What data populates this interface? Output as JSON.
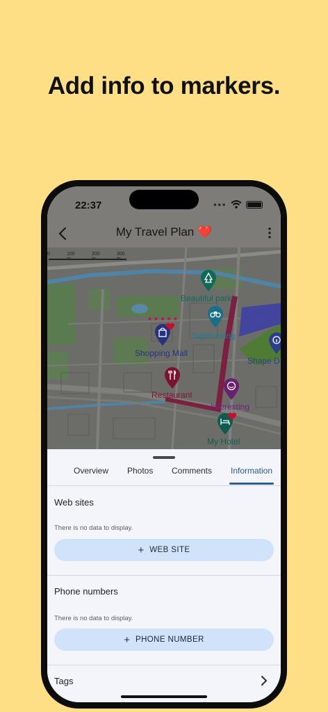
{
  "headline": "Add info to markers.",
  "status_bar": {
    "time": "22:37"
  },
  "app_bar": {
    "title": "My Travel Plan ❤️"
  },
  "map": {
    "scale_labels": [
      "0",
      "100 m",
      "200 m",
      "300 m"
    ],
    "markers": [
      {
        "label": "Beautiful park",
        "icon": "tree-icon",
        "color": "#0f6a58"
      },
      {
        "label": "Sightseeing",
        "icon": "binoculars-icon",
        "color": "#1a6f88"
      },
      {
        "label": "Shopping Mall",
        "icon": "shopping-bag-icon",
        "color": "#26327c"
      },
      {
        "label": "Shape D",
        "icon": "info-icon",
        "color": "#2d3f86"
      },
      {
        "label": "Restaurant",
        "icon": "fork-knife-icon",
        "color": "#7a1232"
      },
      {
        "label": "Interesting",
        "icon": "smiley-icon",
        "color": "#6a1f6f"
      },
      {
        "label": "My Hotel",
        "icon": "bed-icon",
        "color": "#0f5b50"
      }
    ],
    "rating_stars": "★★★★★",
    "favorite_color": "#c3102e"
  },
  "tabs": [
    {
      "label": "Overview"
    },
    {
      "label": "Photos"
    },
    {
      "label": "Comments"
    },
    {
      "label": "Information",
      "active": true
    }
  ],
  "sections": {
    "web_sites": {
      "title": "Web sites",
      "empty": "There is no data to display.",
      "button": "WEB SITE"
    },
    "phone_numbers": {
      "title": "Phone numbers",
      "empty": "There is no data to display.",
      "button": "PHONE NUMBER"
    },
    "tags": {
      "title": "Tags"
    }
  },
  "colors": {
    "background": "#FFDF85",
    "accent": "#2f5f91",
    "button": "#d1e2fb"
  }
}
